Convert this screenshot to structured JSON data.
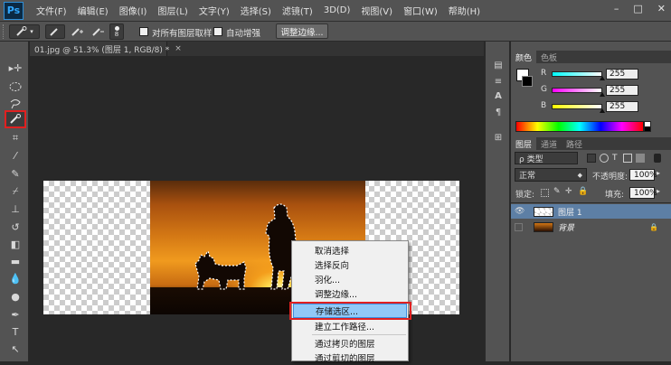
{
  "app": {
    "logo": "Ps"
  },
  "menu": [
    "文件(F)",
    "编辑(E)",
    "图像(I)",
    "图层(L)",
    "文字(Y)",
    "选择(S)",
    "滤镜(T)",
    "3D(D)",
    "视图(V)",
    "窗口(W)",
    "帮助(H)"
  ],
  "window_controls": {
    "minimize": "–",
    "restore": "□",
    "close": "✕"
  },
  "options": {
    "brush_size": "8",
    "sample_all_layers_label": "对所有图层取样",
    "auto_enhance_label": "自动增强",
    "refine_edge_label": "调整边缘..."
  },
  "document": {
    "tab_title": "01.jpg @ 51.3% (图层 1, RGB/8) *",
    "tab_close": "×"
  },
  "color_panel": {
    "tabs": [
      "颜色",
      "色板"
    ],
    "channels": [
      {
        "letter": "R",
        "value": "255",
        "position": 1.0,
        "gradient": "linear-gradient(90deg,#00ffff,#ffffff)"
      },
      {
        "letter": "G",
        "value": "255",
        "position": 1.0,
        "gradient": "linear-gradient(90deg,#ff00ff,#ffffff)"
      },
      {
        "letter": "B",
        "value": "255",
        "position": 1.0,
        "gradient": "linear-gradient(90deg,#ffff00,#ffffff)"
      }
    ]
  },
  "layers_panel": {
    "tabs": [
      "图层",
      "通道",
      "路径"
    ],
    "filter_label": "ρ 类型",
    "blend_mode": "正常",
    "opacity_label": "不透明度:",
    "opacity_value": "100%",
    "lock_label": "锁定:",
    "fill_label": "填充:",
    "fill_value": "100%",
    "layers": [
      {
        "name": "图层 1",
        "visible": true,
        "selected": true,
        "italic": false
      },
      {
        "name": "背景",
        "visible": false,
        "selected": false,
        "italic": true
      }
    ]
  },
  "context_menu": {
    "items": [
      "取消选择",
      "选择反向",
      "羽化...",
      "调整边缘...",
      "存储选区...",
      "建立工作路径...",
      "通过拷贝的图层",
      "通过剪切的图层"
    ],
    "highlighted": "存储选区..."
  },
  "colors": {
    "highlight_box": "#e02020",
    "selected_layer": "#5d7fa5"
  }
}
